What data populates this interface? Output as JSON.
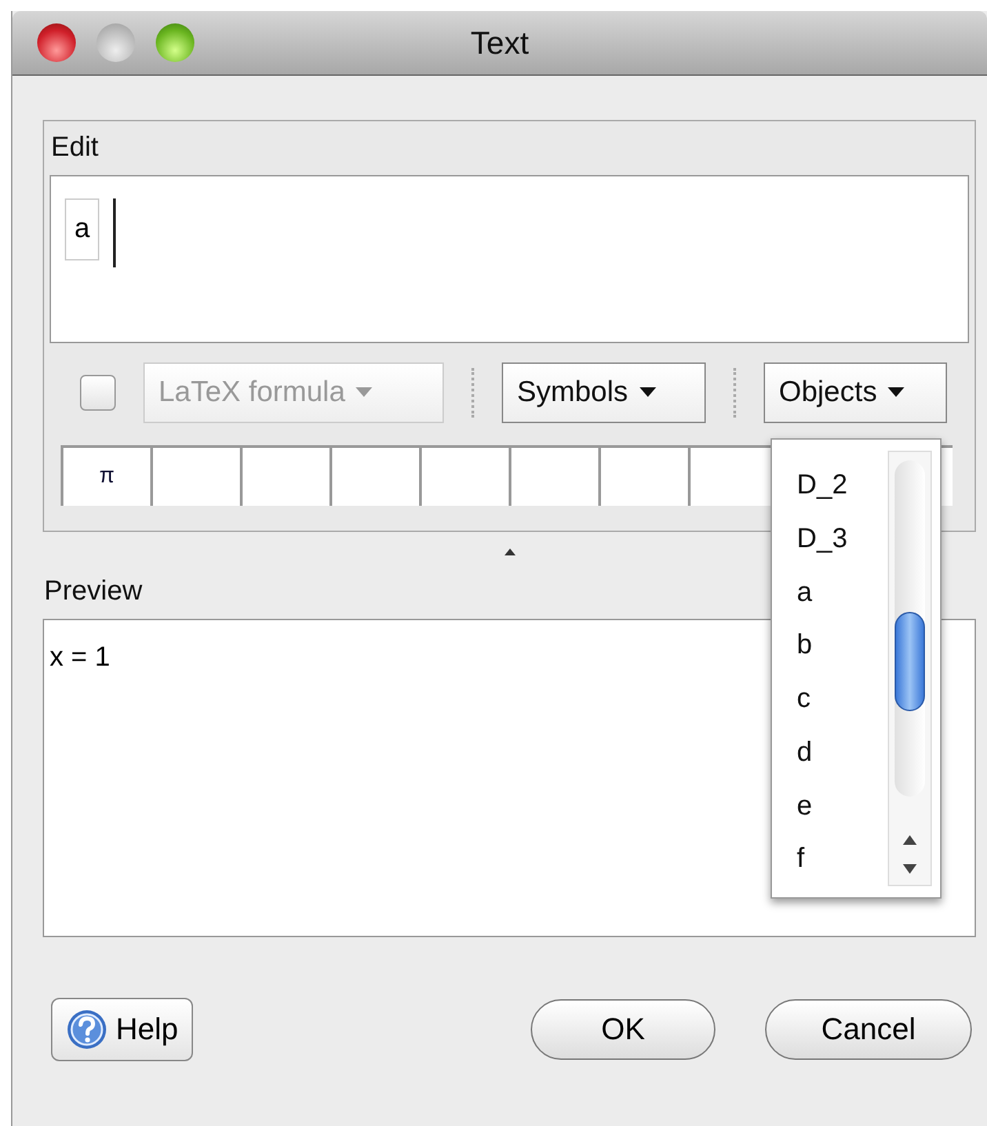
{
  "window": {
    "title": "Text"
  },
  "edit": {
    "label": "Edit",
    "tokens": [
      "a"
    ],
    "latex_checkbox": {
      "checked": false
    },
    "latex_dropdown": {
      "label": "LaTeX formula",
      "disabled": true
    },
    "symbols_button": "Symbols",
    "objects_button": "Objects",
    "symbol_cells": [
      "π"
    ]
  },
  "objects_menu": {
    "items": [
      "D_2",
      "D_3",
      "a",
      "b",
      "c",
      "d",
      "e",
      "f"
    ]
  },
  "preview": {
    "label": "Preview",
    "text": "x = 1"
  },
  "buttons": {
    "help": "Help",
    "ok": "OK",
    "cancel": "Cancel"
  }
}
